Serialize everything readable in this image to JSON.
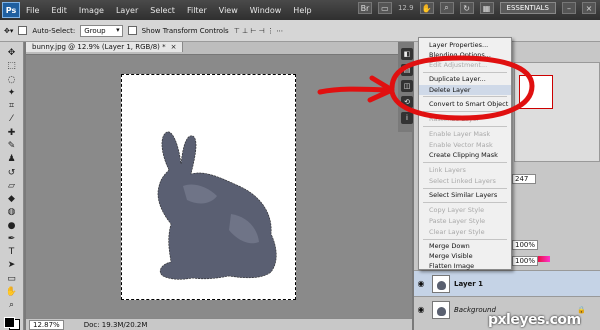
{
  "app": {
    "logo": "Ps"
  },
  "menubar": {
    "items": [
      "File",
      "Edit",
      "Image",
      "Layer",
      "Select",
      "Filter",
      "View",
      "Window",
      "Help"
    ],
    "zoom": "12.9",
    "workspace": "ESSENTIALS"
  },
  "options": {
    "auto_select_label": "Auto-Select:",
    "auto_select_value": "Group",
    "show_transform_label": "Show Transform Controls"
  },
  "document": {
    "tab_title": "bunny.jpg @ 12.9% (Layer 1, RGB/8) *",
    "close": "×",
    "status_zoom": "12.87%",
    "status_doc": "Doc: 19.3M/20.2M"
  },
  "context_menu": {
    "items": [
      {
        "label": "Layer Properties...",
        "disabled": false
      },
      {
        "label": "Blending Options...",
        "disabled": false
      },
      {
        "label": "Edit Adjustment...",
        "disabled": true
      },
      {
        "label": "Duplicate Layer...",
        "disabled": false
      },
      {
        "label": "Delete Layer",
        "disabled": false
      },
      {
        "label": "Convert to Smart Object",
        "disabled": false
      },
      {
        "label": "Rasterize Layer",
        "disabled": true
      },
      {
        "label": "Enable Layer Mask",
        "disabled": true
      },
      {
        "label": "Enable Vector Mask",
        "disabled": true
      },
      {
        "label": "Create Clipping Mask",
        "disabled": false
      },
      {
        "label": "Link Layers",
        "disabled": true
      },
      {
        "label": "Select Linked Layers",
        "disabled": true
      },
      {
        "label": "Select Similar Layers",
        "disabled": false
      },
      {
        "label": "Copy Layer Style",
        "disabled": true
      },
      {
        "label": "Paste Layer Style",
        "disabled": true
      },
      {
        "label": "Clear Layer Style",
        "disabled": true
      },
      {
        "label": "Merge Down",
        "disabled": false
      },
      {
        "label": "Merge Visible",
        "disabled": false
      },
      {
        "label": "Flatten Image",
        "disabled": false
      }
    ],
    "highlighted": "Delete Layer"
  },
  "panels": {
    "field_value": "247",
    "opacity_value": "100%",
    "fill_value": "100%",
    "layers": [
      {
        "name": "Layer 1",
        "active": true
      },
      {
        "name": "Background",
        "active": false
      }
    ]
  },
  "watermark": "pxleyes.com",
  "colors": {
    "annotation": "#e01010",
    "menu_highlight": "#cfd9e8"
  }
}
